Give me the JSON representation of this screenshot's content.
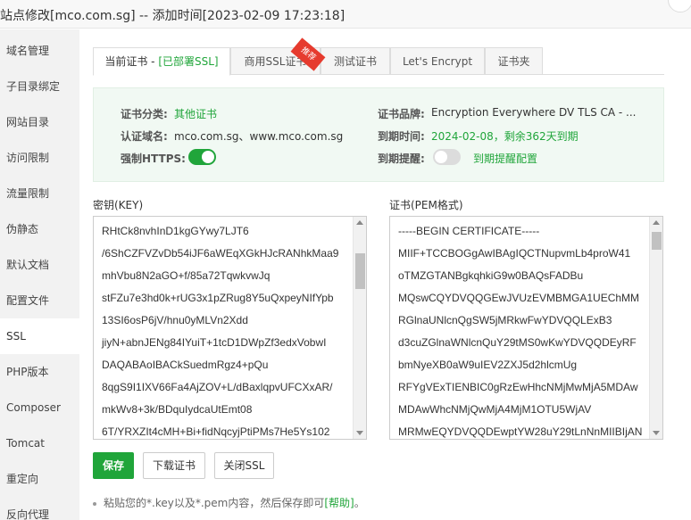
{
  "window": {
    "title": "站点修改[mco.com.sg] -- 添加时间[2023-02-09 17:23:18]"
  },
  "sidebar": {
    "items": [
      {
        "label": "域名管理"
      },
      {
        "label": "子目录绑定"
      },
      {
        "label": "网站目录"
      },
      {
        "label": "访问限制"
      },
      {
        "label": "流量限制"
      },
      {
        "label": "伪静态"
      },
      {
        "label": "默认文档"
      },
      {
        "label": "配置文件"
      },
      {
        "label": "SSL",
        "active": true
      },
      {
        "label": "PHP版本"
      },
      {
        "label": "Composer"
      },
      {
        "label": "Tomcat"
      },
      {
        "label": "重定向"
      },
      {
        "label": "反向代理"
      }
    ]
  },
  "tabs": {
    "current_prefix": "当前证书 - ",
    "current_status": "[已部署SSL]",
    "commercial": "商用SSL证书",
    "commercial_badge": "推荐",
    "test": "测试证书",
    "letsencrypt": "Let's Encrypt",
    "folder": "证书夹"
  },
  "info": {
    "category_label": "证书分类:",
    "category_value": "其他证书",
    "brand_label": "证书品牌:",
    "brand_value": "Encryption Everywhere DV TLS CA - ...",
    "domains_label": "认证域名:",
    "domains_value": "mco.com.sg、www.mco.com.sg",
    "expiry_label": "到期时间:",
    "expiry_value": "2024-02-08，剩余362天到期",
    "https_label": "强制HTTPS:",
    "https_on": true,
    "reminder_label": "到期提醒:",
    "reminder_on": false,
    "reminder_link": "到期提醒配置"
  },
  "key": {
    "label": "密钥(KEY)",
    "lines": [
      "RHtCk8nvhInD1kgGYwy7LJT6",
      "/6ShCZFVZvDb54iJF6aWEqXGkHJcRANhkMaa9",
      "mhVbu8N2aGO+f/85a72TqwkvwJq",
      "stFZu7e3hd0k+rUG3x1pZRug8Y5uQxpeyNIfYpb",
      "13SI6osP6jV/hnu0yMLVn2Xdd",
      "jiyN+abnJENg84IYuiT+1tcD1DWpZf3edxVobwI",
      "DAQABAoIBACkSuedmRgz4+pQu",
      "8qgS9I1IXV66Fa4AjZOV+L/dBaxlqpvUFCXxAR/",
      "mkWv8+3k/BDquIydcaUtEmt08",
      "6T/YRXZIt4cMH+Bi+fidNqcyjPtiPMs7He5Ys102"
    ]
  },
  "cert": {
    "label": "证书(PEM格式)",
    "lines": [
      "-----BEGIN CERTIFICATE-----",
      "MIIF+TCCBOGgAwIBAgIQCTNupvmLb4proW41",
      "oTMZGTANBgkqhkiG9w0BAQsFADBu",
      "MQswCQYDVQQGEwJVUzEVMBMGA1UEChMM",
      "RGlnaUNlcnQgSW5jMRkwFwYDVQQLExB3",
      "d3cuZGlnaWNlcnQuY29tMS0wKwYDVQQDEyRF",
      "bmNyeXB0aW9uIEV2ZXJ5d2hlcmUg",
      "RFYgVExTIENBIC0gRzEwHhcNMjMwMjA5MDAw",
      "MDAwWhcNMjQwMjA4MjM1OTU5WjAV",
      "MRMwEQYDVQQDEwptYW28uY29tLnNnMIIBIjAN"
    ]
  },
  "buttons": {
    "save": "保存",
    "download": "下载证书",
    "disable": "关闭SSL"
  },
  "tips": {
    "line1_prefix": "粘贴您的*.key以及*.pem内容，然后保存即可",
    "line1_link": "[帮助]",
    "line1_suffix": "。"
  },
  "colors": {
    "accent": "#20a53a",
    "badge": "#e63b2e"
  }
}
